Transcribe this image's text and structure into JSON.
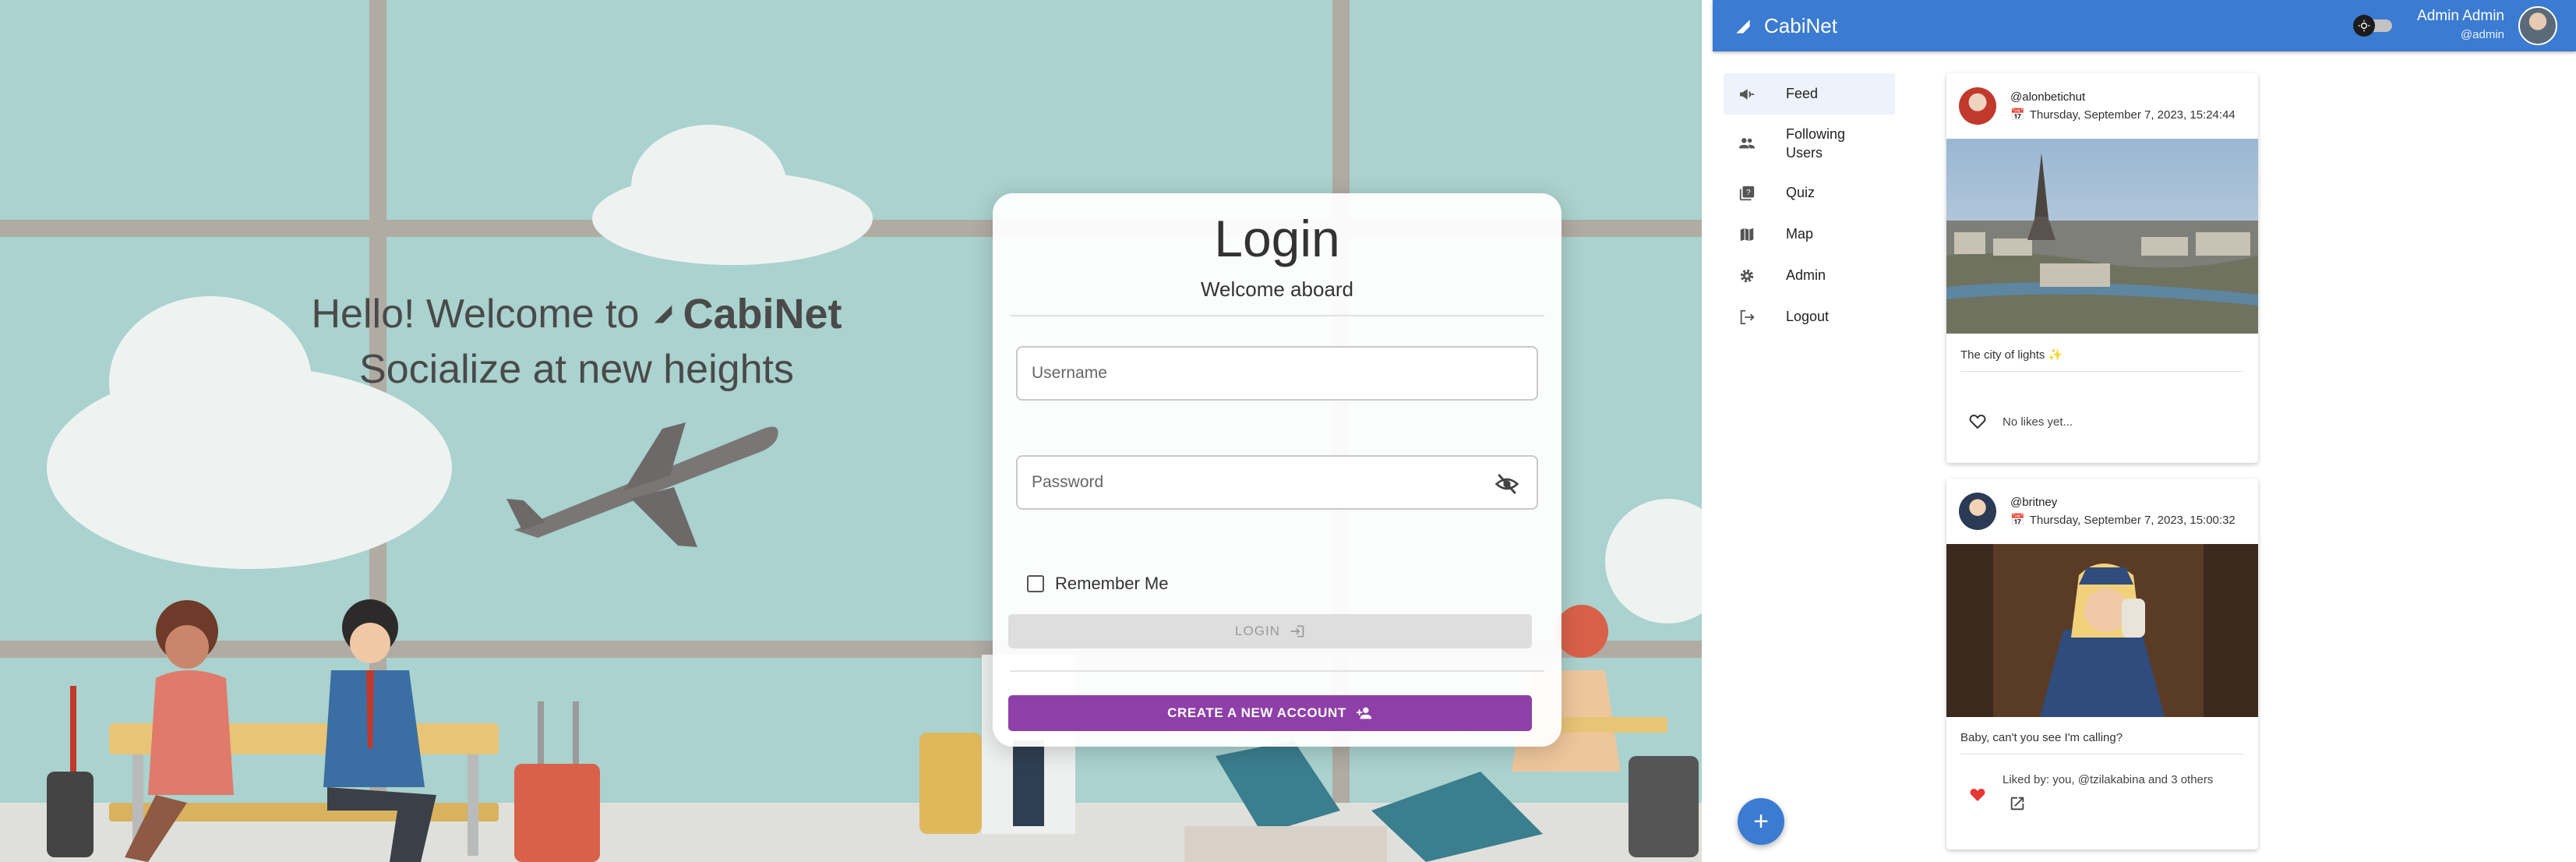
{
  "login": {
    "welcome_prefix": "Hello! Welcome to",
    "brand": "CabiNet",
    "tagline": "Socialize at new heights",
    "title": "Login",
    "subtitle": "Welcome aboard",
    "username_placeholder": "Username",
    "password_placeholder": "Password",
    "remember_label": "Remember Me",
    "login_button": "LOGIN",
    "create_button": "CREATE A NEW ACCOUNT"
  },
  "app": {
    "brand": "CabiNet",
    "user": {
      "name": "Admin Admin",
      "handle": "@admin"
    },
    "nav": [
      {
        "label": "Feed",
        "icon": "megaphone-icon",
        "active": true
      },
      {
        "label": "Following Users",
        "icon": "people-icon",
        "active": false
      },
      {
        "label": "Quiz",
        "icon": "quiz-icon",
        "active": false
      },
      {
        "label": "Map",
        "icon": "map-icon",
        "active": false
      },
      {
        "label": "Admin",
        "icon": "gear-icon",
        "active": false
      },
      {
        "label": "Logout",
        "icon": "logout-icon",
        "active": false
      }
    ],
    "fab_label": "+",
    "posts": [
      {
        "user": "@alonbetichut",
        "date": "Thursday, September 7, 2023, 15:24:44",
        "caption": "The city of lights ✨",
        "likes": "No likes yet...",
        "liked": false
      },
      {
        "user": "@britney",
        "date": "Thursday, September 7, 2023, 15:00:32",
        "caption": "Baby, can't you see I'm calling?",
        "likes": "Liked by: you, @tzilakabina and 3 others",
        "liked": true
      }
    ]
  },
  "colors": {
    "primary": "#3b7bd1",
    "create_button": "#8e3fa8",
    "scene_sky": "#aad2ce",
    "like_red": "#e53935"
  }
}
